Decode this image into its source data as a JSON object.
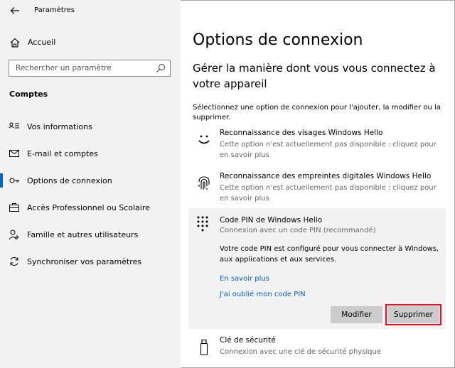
{
  "app": {
    "title": "Paramètres"
  },
  "sidebar": {
    "home_label": "Accueil",
    "search_placeholder": "Rechercher un paramètre",
    "section_label": "Comptes",
    "items": [
      {
        "label": "Vos informations",
        "icon": "person-card-icon"
      },
      {
        "label": "E-mail et comptes",
        "icon": "mail-icon"
      },
      {
        "label": "Options de connexion",
        "icon": "key-icon",
        "active": true
      },
      {
        "label": "Accès Professionnel ou Scolaire",
        "icon": "briefcase-icon"
      },
      {
        "label": "Famille et autres utilisateurs",
        "icon": "people-icon"
      },
      {
        "label": "Synchroniser vos paramètres",
        "icon": "sync-icon"
      }
    ]
  },
  "main": {
    "title": "Options de connexion",
    "subheading": "Gérer la manière dont vous vous connectez à votre appareil",
    "description": "Sélectionnez une option de connexion pour l'ajouter, la modifier ou la supprimer.",
    "options": [
      {
        "title": "Reconnaissance des visages Windows Hello",
        "subtitle": "Cette option n'est actuellement pas disponible : cliquez pour en savoir plus",
        "icon": "face-icon"
      },
      {
        "title": "Reconnaissance des empreintes digitales Windows Hello",
        "subtitle": "Cette option n'est actuellement pas disponible : cliquez pour en savoir plus",
        "icon": "fingerprint-icon"
      }
    ],
    "pin": {
      "title": "Code PIN de Windows Hello",
      "subtitle": "Connexion avec un code PIN (recommandé)",
      "description": "Votre code PIN est configuré pour vous connecter à Windows, aux applications et aux services.",
      "learn_more": "En savoir plus",
      "forgot": "J'ai oublié mon code PIN",
      "modify_label": "Modifier",
      "delete_label": "Supprimer",
      "icon": "keypad-icon"
    },
    "security_key": {
      "title": "Clé de sécurité",
      "subtitle": "Connexion avec une clé de sécurité physique",
      "icon": "usb-key-icon"
    }
  },
  "colors": {
    "accent": "#0067c0",
    "link": "#0063b1",
    "highlight": "#e81123"
  }
}
